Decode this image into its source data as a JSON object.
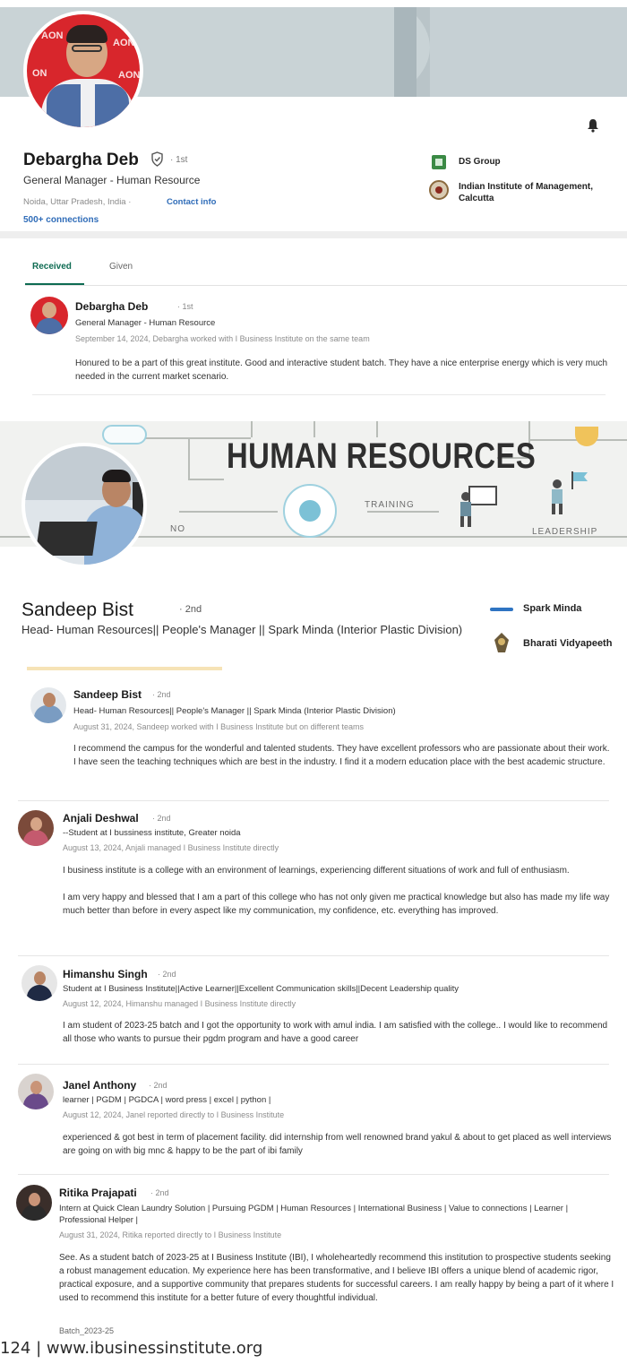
{
  "card1": {
    "name": "Debargha Deb",
    "degree": "· 1st",
    "headline": "General Manager - Human Resource",
    "location": "Noida, Uttar Pradesh, India ·",
    "contact_info": "Contact info",
    "connections": "500+ connections",
    "orgs": [
      "DS Group",
      "Indian Institute of Management, Calcutta"
    ],
    "tabs": {
      "received": "Received",
      "given": "Given"
    },
    "review": {
      "name": "Debargha Deb",
      "degree": "· 1st",
      "headline": "General Manager - Human Resource",
      "date": "September 14, 2024, Debargha worked with I Business Institute on the same team",
      "text": "Honured to be a part of this great institute. Good and interactive student batch. They have a nice enterprise energy which is very much needed in the current market scenario."
    }
  },
  "card2": {
    "banner_title": "HUMAN RESOURCES",
    "banner_words": [
      "TRAINING",
      "LEADERSHIP",
      "NO"
    ],
    "name": "Sandeep Bist",
    "degree": "· 2nd",
    "headline": "Head- Human Resources|| People's Manager || Spark Minda (Interior Plastic Division)",
    "orgs": [
      "Spark Minda",
      "Bharati Vidyapeeth"
    ]
  },
  "reviews": [
    {
      "name": "Sandeep Bist",
      "degree": "· 2nd",
      "headline": "Head- Human Resources|| People's Manager || Spark Minda (Interior Plastic Division)",
      "date": "August 31, 2024, Sandeep worked with I Business Institute but on different teams",
      "text": "I recommend the campus for the wonderful and talented students. They have excellent professors who are passionate about their work. I have seen the teaching techniques which are best in the industry. I find it a modern education place with the best academic structure."
    },
    {
      "name": "Anjali Deshwal",
      "degree": "· 2nd",
      "headline": "--Student at I bussiness institute, Greater noida",
      "date": "August 13, 2024, Anjali managed I Business Institute directly",
      "text": "I business institute is a college with an environment of learnings, experiencing different situations of work and full of enthusiasm.",
      "text2": "I am very happy and blessed that I am a part of this college who has not only given me practical knowledge but also has made my life way much better than before in every aspect like my communication, my confidence, etc. everything has improved."
    },
    {
      "name": "Himanshu Singh",
      "degree": "· 2nd",
      "headline": "Student at I Business Institute||Active Learner||Excellent Communication skills||Decent Leadership quality",
      "date": "August 12, 2024, Himanshu managed I Business Institute directly",
      "text": "I am student of 2023-25 batch and I got the opportunity to work with amul india. I am satisfied with the college.. I would like to recommend all those who wants to pursue their pgdm program and have a good career"
    },
    {
      "name": "Janel Anthony",
      "degree": "· 2nd",
      "headline": "learner | PGDM | PGDCA | word press | excel | python |",
      "date": "August 12, 2024, Janel reported directly to I Business Institute",
      "text": "experienced & got best in term of placement facility. did internship from well renowned brand yakul & about to get placed as well interviews are going on with big mnc & happy to be the part of ibi family"
    },
    {
      "name": "Ritika Prajapati",
      "degree": "· 2nd",
      "headline": "Intern at Quick Clean Laundry Solution | Pursuing PGDM | Human Resources | International Business | Value to connections | Learner | Professional Helper |",
      "date": "August 31, 2024, Ritika reported directly to I Business Institute",
      "text": "See. As a student batch of 2023-25 at I Business Institute (IBI), I wholeheartedly recommend this institution to prospective students seeking a robust management education. My experience here has been transformative, and I believe IBI offers a unique blend of academic rigor, practical exposure, and a supportive community that prepares students for successful careers. I am really happy by being a part of it where I used to recommend this institute for a better future of every thoughtful individual.",
      "text2": "Batch_2023-25"
    }
  ],
  "footer": "124 | www.ibusinessinstitute.org"
}
